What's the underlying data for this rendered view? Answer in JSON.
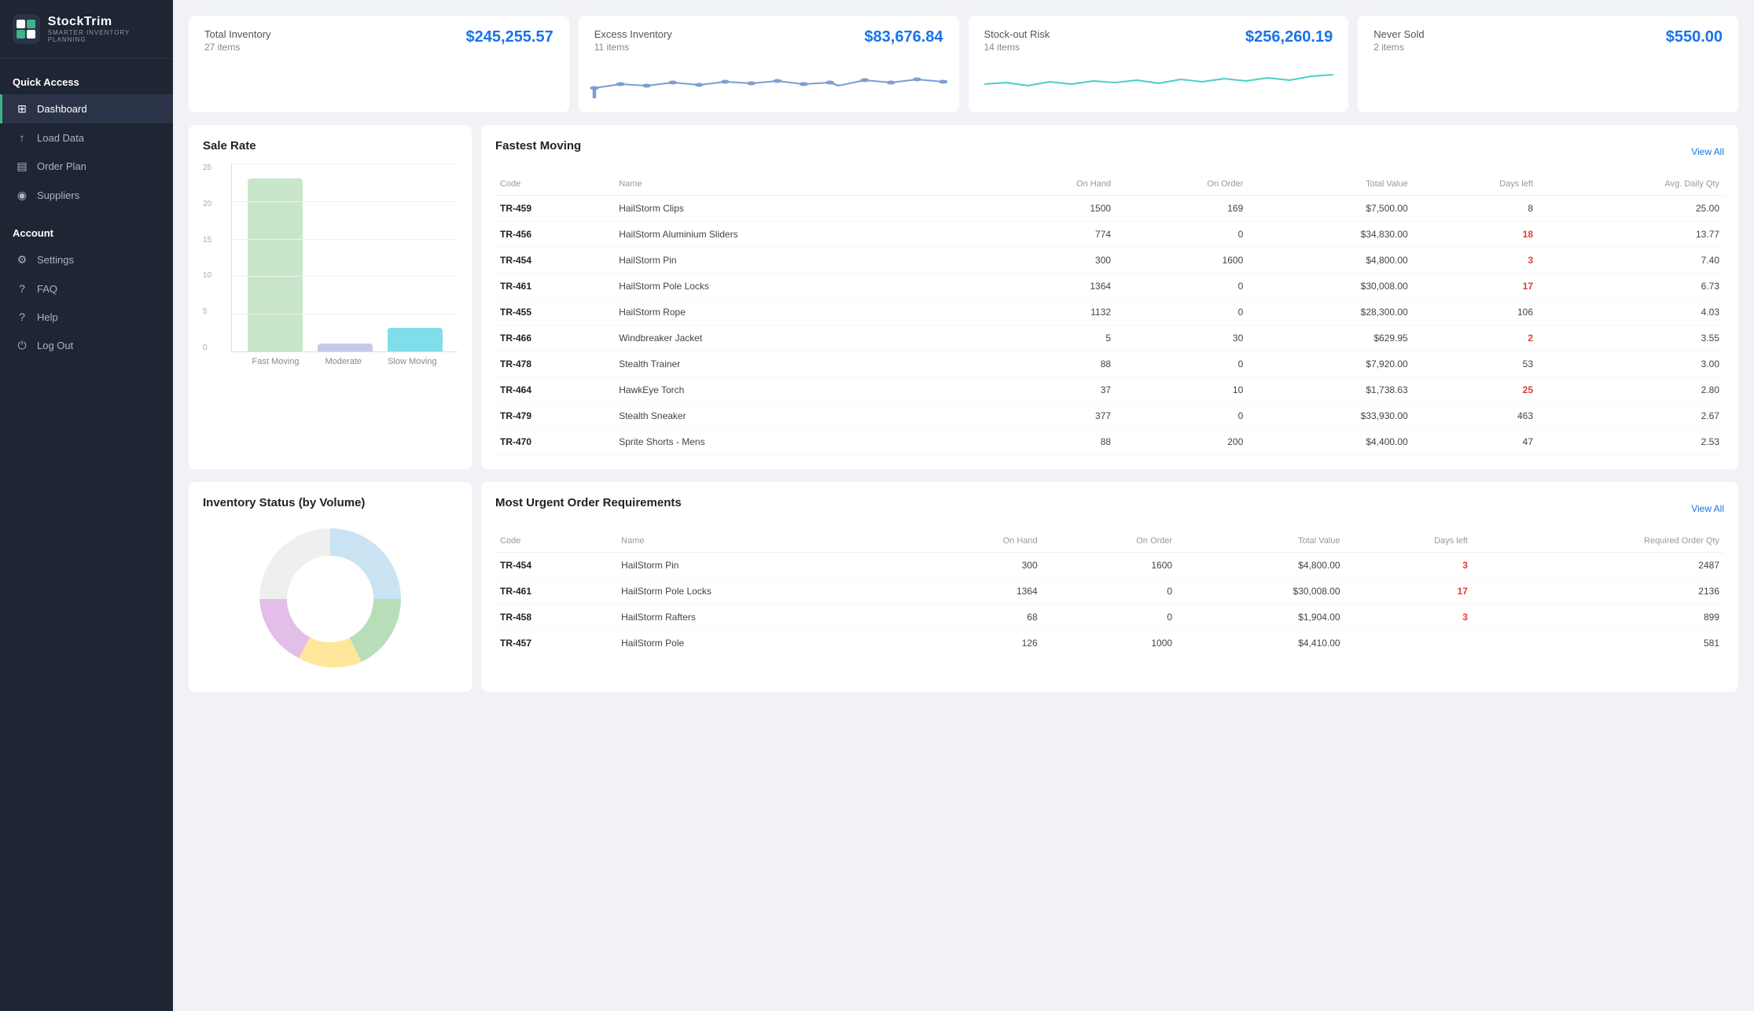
{
  "logo": {
    "name": "StockTrim",
    "sub": "SMARTER INVENTORY PLANNING",
    "icon": "ST"
  },
  "sidebar": {
    "quick_access_label": "Quick Access",
    "account_label": "Account",
    "items_quick": [
      {
        "id": "dashboard",
        "label": "Dashboard",
        "icon": "⊞",
        "active": true
      },
      {
        "id": "load-data",
        "label": "Load Data",
        "icon": "↑"
      },
      {
        "id": "order-plan",
        "label": "Order Plan",
        "icon": "▤"
      },
      {
        "id": "suppliers",
        "label": "Suppliers",
        "icon": "◉"
      }
    ],
    "items_account": [
      {
        "id": "settings",
        "label": "Settings",
        "icon": "⚙"
      },
      {
        "id": "faq",
        "label": "FAQ",
        "icon": "?"
      },
      {
        "id": "help",
        "label": "Help",
        "icon": "?"
      },
      {
        "id": "logout",
        "label": "Log Out",
        "icon": "⏻"
      }
    ]
  },
  "stat_cards": [
    {
      "title": "Total Inventory",
      "value": "$245,255.57",
      "items": "27 items",
      "has_chart": false
    },
    {
      "title": "Excess Inventory",
      "value": "$83,676.84",
      "items": "11 items",
      "has_chart": true,
      "chart_color": "#7b9fd4"
    },
    {
      "title": "Stock-out Risk",
      "value": "$256,260.19",
      "items": "14 items",
      "has_chart": true,
      "chart_color": "#4dd0c4"
    },
    {
      "title": "Never Sold",
      "value": "$550.00",
      "items": "2 items",
      "has_chart": false
    }
  ],
  "sale_rate": {
    "title": "Sale Rate",
    "bars": [
      {
        "label": "Fast Moving",
        "value": 23,
        "color": "#c8e6c9",
        "max": 25
      },
      {
        "label": "Moderate",
        "value": 1,
        "color": "#c5cae9",
        "max": 25
      },
      {
        "label": "Slow Moving",
        "value": 3,
        "color": "#80deea",
        "max": 25
      }
    ],
    "y_labels": [
      "25",
      "20",
      "15",
      "10",
      "5",
      "0"
    ]
  },
  "fastest_moving": {
    "title": "Fastest Moving",
    "view_all": "View All",
    "columns": [
      "Code",
      "Name",
      "On Hand",
      "On Order",
      "Total Value",
      "Days left",
      "Avg. Daily Qty"
    ],
    "rows": [
      {
        "code": "TR-459",
        "name": "HailStorm Clips",
        "on_hand": "1500",
        "on_order": "169",
        "total_value": "$7,500.00",
        "days_left": "8",
        "days_red": false,
        "avg_daily": "25.00"
      },
      {
        "code": "TR-456",
        "name": "HailStorm Aluminium Sliders",
        "on_hand": "774",
        "on_order": "0",
        "total_value": "$34,830.00",
        "days_left": "18",
        "days_red": true,
        "avg_daily": "13.77"
      },
      {
        "code": "TR-454",
        "name": "HailStorm Pin",
        "on_hand": "300",
        "on_order": "1600",
        "total_value": "$4,800.00",
        "days_left": "3",
        "days_red": true,
        "avg_daily": "7.40"
      },
      {
        "code": "TR-461",
        "name": "HailStorm Pole Locks",
        "on_hand": "1364",
        "on_order": "0",
        "total_value": "$30,008.00",
        "days_left": "17",
        "days_red": true,
        "avg_daily": "6.73"
      },
      {
        "code": "TR-455",
        "name": "HailStorm Rope",
        "on_hand": "1132",
        "on_order": "0",
        "total_value": "$28,300.00",
        "days_left": "106",
        "days_red": false,
        "avg_daily": "4.03"
      },
      {
        "code": "TR-466",
        "name": "Windbreaker Jacket",
        "on_hand": "5",
        "on_order": "30",
        "total_value": "$629.95",
        "days_left": "2",
        "days_red": true,
        "avg_daily": "3.55"
      },
      {
        "code": "TR-478",
        "name": "Stealth Trainer",
        "on_hand": "88",
        "on_order": "0",
        "total_value": "$7,920.00",
        "days_left": "53",
        "days_red": false,
        "avg_daily": "3.00"
      },
      {
        "code": "TR-464",
        "name": "HawkEye Torch",
        "on_hand": "37",
        "on_order": "10",
        "total_value": "$1,738.63",
        "days_left": "25",
        "days_red": true,
        "avg_daily": "2.80"
      },
      {
        "code": "TR-479",
        "name": "Stealth Sneaker",
        "on_hand": "377",
        "on_order": "0",
        "total_value": "$33,930.00",
        "days_left": "463",
        "days_red": false,
        "avg_daily": "2.67"
      },
      {
        "code": "TR-470",
        "name": "Sprite Shorts - Mens",
        "on_hand": "88",
        "on_order": "200",
        "total_value": "$4,400.00",
        "days_left": "47",
        "days_red": false,
        "avg_daily": "2.53"
      }
    ]
  },
  "inventory_status": {
    "title": "Inventory Status (by Volume)"
  },
  "urgent_orders": {
    "title": "Most Urgent Order Requirements",
    "view_all": "View All",
    "columns": [
      "Code",
      "Name",
      "On Hand",
      "On Order",
      "Total Value",
      "Days left",
      "Required Order Qty"
    ],
    "rows": [
      {
        "code": "TR-454",
        "name": "HailStorm Pin",
        "on_hand": "300",
        "on_order": "1600",
        "total_value": "$4,800.00",
        "days_left": "3",
        "days_red": true,
        "req_order_qty": "2487"
      },
      {
        "code": "TR-461",
        "name": "HailStorm Pole Locks",
        "on_hand": "1364",
        "on_order": "0",
        "total_value": "$30,008.00",
        "days_left": "17",
        "days_red": true,
        "req_order_qty": "2136"
      },
      {
        "code": "TR-458",
        "name": "HailStorm Rafters",
        "on_hand": "68",
        "on_order": "0",
        "total_value": "$1,904.00",
        "days_left": "3",
        "days_red": true,
        "req_order_qty": "899"
      },
      {
        "code": "TR-457",
        "name": "HailStorm Pole",
        "on_hand": "126",
        "on_order": "1000",
        "total_value": "$4,410.00",
        "days_left": "",
        "days_red": false,
        "req_order_qty": "581"
      }
    ]
  }
}
